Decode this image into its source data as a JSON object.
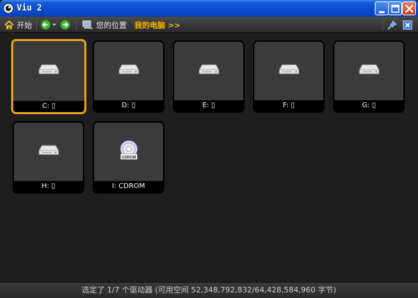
{
  "window": {
    "title": "Viu 2"
  },
  "toolbar": {
    "start_label": "开始",
    "location_label": "您的位置",
    "breadcrumb": "我的电脑 >>"
  },
  "drives": [
    {
      "label": "C: ▯",
      "type": "disk"
    },
    {
      "label": "D: ▯",
      "type": "disk"
    },
    {
      "label": "E: ▯",
      "type": "disk"
    },
    {
      "label": "F: ▯",
      "type": "disk"
    },
    {
      "label": "G: ▯",
      "type": "disk"
    },
    {
      "label": "H: ▯",
      "type": "disk"
    },
    {
      "label": "I: CDROM",
      "type": "cdrom",
      "badge": "CDROM"
    }
  ],
  "status": {
    "text": "选定了 1/7 个驱动器 (可用空间 52,348,792,832/64,428,584,960 字节)"
  },
  "colors": {
    "selection": "#e6a21d",
    "breadcrumb": "#ffb400",
    "titlebar": "#0a4fcf"
  },
  "icons": {
    "app": "viu-app-icon",
    "home": "home-icon",
    "back": "back-arrow-icon",
    "forward": "forward-arrow-icon",
    "location": "computer-icon",
    "pin": "pin-icon",
    "view": "view-mode-icon",
    "disk": "hard-drive-icon",
    "cd": "cd-icon"
  }
}
